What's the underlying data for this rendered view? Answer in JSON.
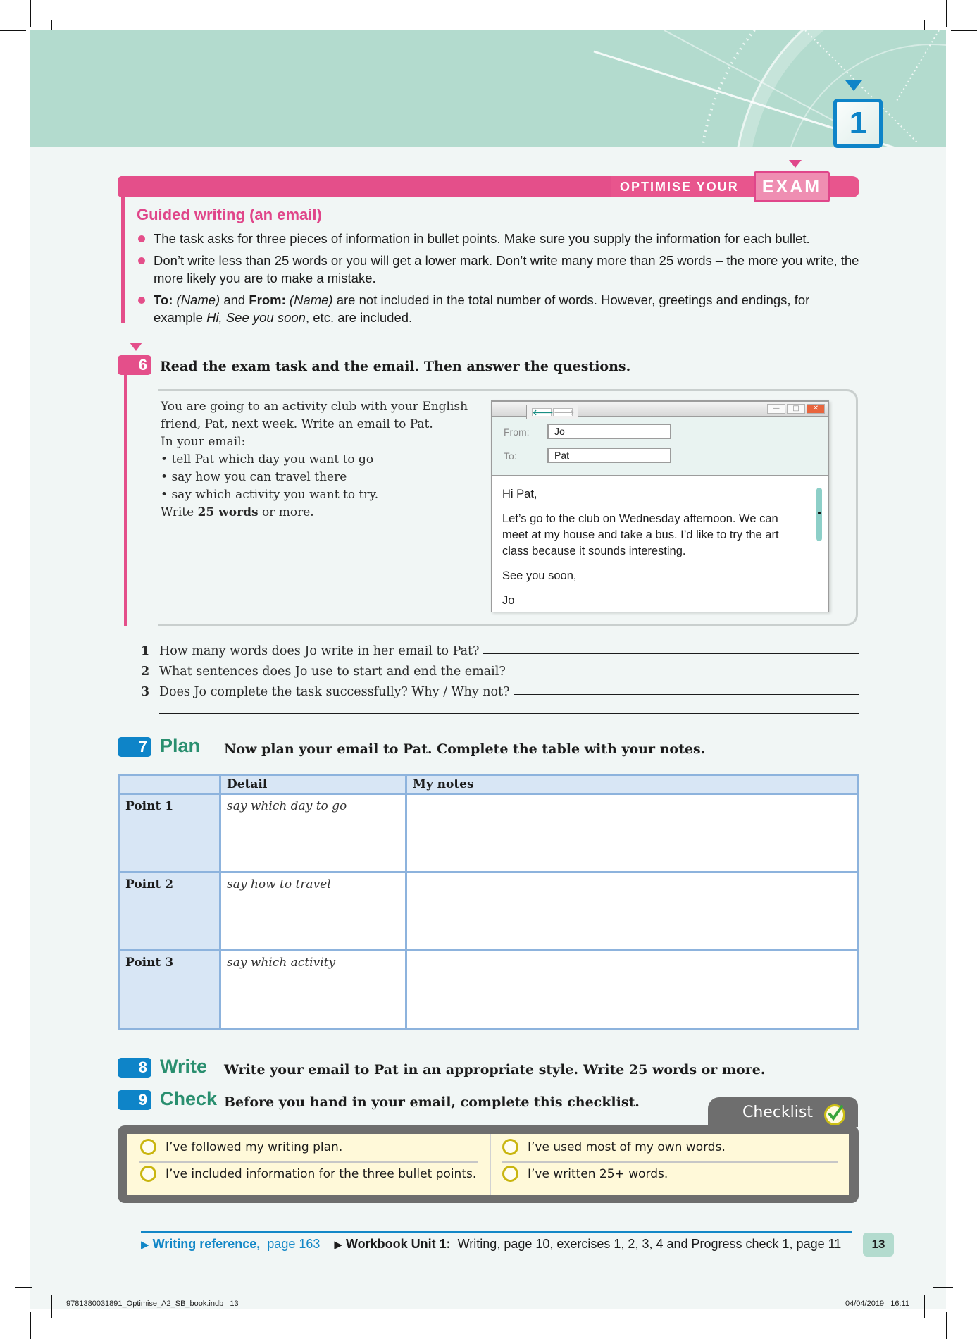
{
  "unit": {
    "number": "1"
  },
  "exam_banner": {
    "prefix": "OPTIMISE YOUR",
    "highlight": "EXAM"
  },
  "tips": {
    "title": "Guided writing (an email)",
    "items": [
      {
        "text": "The task asks for three pieces of information in bullet points. Make sure you supply the information for each bullet."
      },
      {
        "text": "Don’t write less than 25 words or you will get a lower mark. Don’t write many more than 25 words – the more you write, the more likely you are to make a mistake."
      },
      {
        "bold1": "To:",
        "ital1": " (Name)",
        "mid": " and ",
        "bold2": "From:",
        "ital2": " (Name)",
        "tail1": " are not included in the total number of words. However, greetings and endings, for example ",
        "ital3": "Hi, See you soon",
        "tail2": ", etc. are included."
      }
    ]
  },
  "exercise6": {
    "number": "6",
    "instruction": "Read the exam task and the email. Then answer the questions.",
    "task": {
      "intro": "You are going to an activity club with your English friend, Pat, next week. Write an email to Pat.",
      "lead": "In your email:",
      "bullets": [
        "tell Pat which day you want to go",
        "say how you can travel there",
        "say which activity you want to try."
      ],
      "closing_pre": "Write ",
      "closing_bold": "25 words",
      "closing_post": " or more."
    },
    "email": {
      "nav_back": "🡐",
      "nav_forward": "🡒",
      "from_label": "From:",
      "from_value": "Jo",
      "to_label": "To:",
      "to_value": "Pat",
      "greeting": "Hi Pat,",
      "body": "Let’s go to the club on Wednesday afternoon. We can meet at my house and take a bus. I’d like to try the art class because it sounds interesting.",
      "signoff": "See you soon,",
      "signature": "Jo"
    },
    "questions": [
      {
        "num": "1",
        "text": "How many words does Jo write in her email to Pat?"
      },
      {
        "num": "2",
        "text": "What sentences does Jo use to start and end the email?"
      },
      {
        "num": "3",
        "text": "Does Jo complete the task successfully? Why / Why not?"
      }
    ]
  },
  "exercise7": {
    "number": "7",
    "word": "Plan",
    "instruction": "Now plan your email to Pat. Complete the table with your notes.",
    "table": {
      "headers": [
        "",
        "Detail",
        "My notes"
      ],
      "rows": [
        {
          "point": "Point 1",
          "detail": "say which day to go",
          "notes": ""
        },
        {
          "point": "Point 2",
          "detail": "say how to travel",
          "notes": ""
        },
        {
          "point": "Point 3",
          "detail": "say which activity",
          "notes": ""
        }
      ]
    }
  },
  "exercise8": {
    "number": "8",
    "word": "Write",
    "instruction": "Write your email to Pat in an appropriate style. Write 25 words or more."
  },
  "exercise9": {
    "number": "9",
    "word": "Check",
    "instruction": "Before you hand in your email, complete this checklist."
  },
  "checklist": {
    "title": "Checklist",
    "items": [
      {
        "text": "I’ve followed my writing plan.",
        "checked": false
      },
      {
        "text": "I’ve included information for the three bullet points.",
        "checked": false
      },
      {
        "text": "I’ve used most of my own words.",
        "checked": false
      },
      {
        "text": "I’ve written 25+ words.",
        "checked": false
      }
    ]
  },
  "footer": {
    "ref_label": "Writing reference,",
    "ref_page": "page 163",
    "workbook_label": "Workbook Unit 1:",
    "workbook_text": "Writing, page 10, exercises 1, 2, 3, 4 and Progress check 1, page 11",
    "page_number": "13"
  },
  "slug": {
    "file": "9781380031891_Optimise_A2_SB_book.indb   13",
    "datetime": "04/04/2019   16:11"
  },
  "colors": {
    "teal_header": "#b3dbce",
    "pink": "#e44f8a",
    "blue": "#0e84c8",
    "green": "#2a8f6f",
    "checklist_gray": "#6e6e6e",
    "checklist_yellow": "#fff9d9"
  }
}
